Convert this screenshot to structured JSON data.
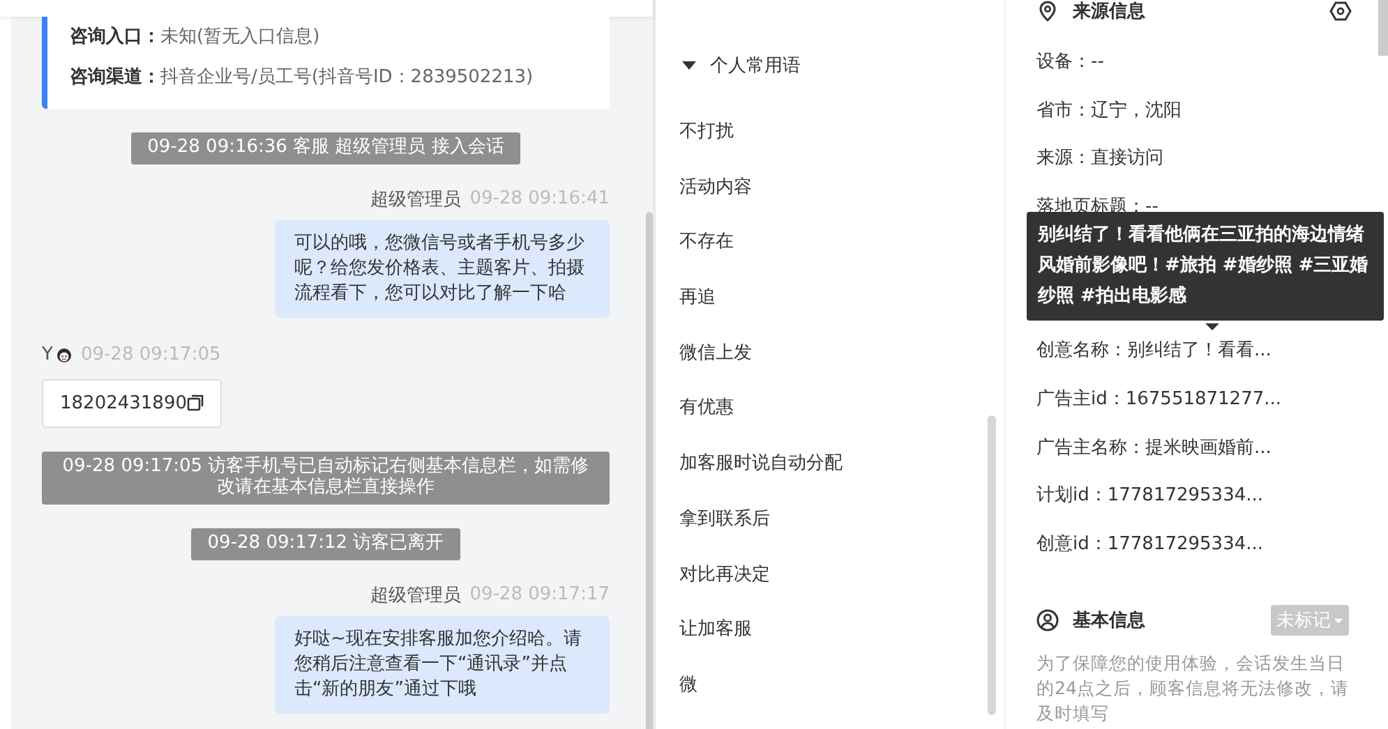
{
  "chat": {
    "source_card": {
      "rows": [
        {
          "label": "咨询入口：",
          "value": "未知(暂无入口信息)"
        },
        {
          "label": "咨询渠道：",
          "value": "抖音企业号/员工号(抖音号ID：2839502213)"
        }
      ]
    },
    "messages": [
      {
        "kind": "system",
        "text": "09-28 09:16:36 客服 超级管理员 接入会话"
      },
      {
        "kind": "agent",
        "sender": "超级管理员",
        "time": "09-28 09:16:41",
        "text": "可以的哦，您微信号或者手机号多少呢？给您发价格表、主题客片、拍摄流程看下，您可以对比了解一下哈"
      },
      {
        "kind": "visitor",
        "sender": "Y",
        "time": "09-28 09:17:05",
        "text": "18202431890"
      },
      {
        "kind": "system",
        "text": "09-28 09:17:05 访客手机号已自动标记右侧基本信息栏，如需修改请在基本信息栏直接操作"
      },
      {
        "kind": "system",
        "text": "09-28 09:17:12 访客已离开"
      },
      {
        "kind": "agent",
        "sender": "超级管理员",
        "time": "09-28 09:17:17",
        "text": "好哒~现在安排客服加您介绍哈。请您稍后注意查看一下“通讯录”并点击“新的朋友”通过下哦"
      }
    ]
  },
  "phrases": {
    "group": {
      "label": "个人常用语",
      "expanded": true
    },
    "items": [
      "不打扰",
      "活动内容",
      "不存在",
      "再追",
      "微信上发",
      "有优惠",
      "加客服时说自动分配",
      "拿到联系后",
      "对比再决定",
      "让加客服",
      "微"
    ]
  },
  "source_info": {
    "title": "来源信息",
    "rows_above": [
      "设备：--",
      "省市：辽宁，沈阳",
      "来源：直接访问",
      "落地页标题：--"
    ],
    "rows_below": [
      "创意名称：别纠结了！看看...",
      "广告主id：167551871277...",
      "广告主名称：提米映画婚前...",
      "计划id：177817295334...",
      "创意id：177817295334..."
    ],
    "tooltip": "别纠结了！看看他俩在三亚拍的海边情绪风婚前影像吧！#旅拍 #婚纱照 #三亚婚纱照 #拍出电影感"
  },
  "basic_info": {
    "title": "基本信息",
    "tag": "未标记",
    "notice": "为了保障您的使用体验，会话发生当日的24点之后，顾客信息将无法修改，请及时填写"
  }
}
